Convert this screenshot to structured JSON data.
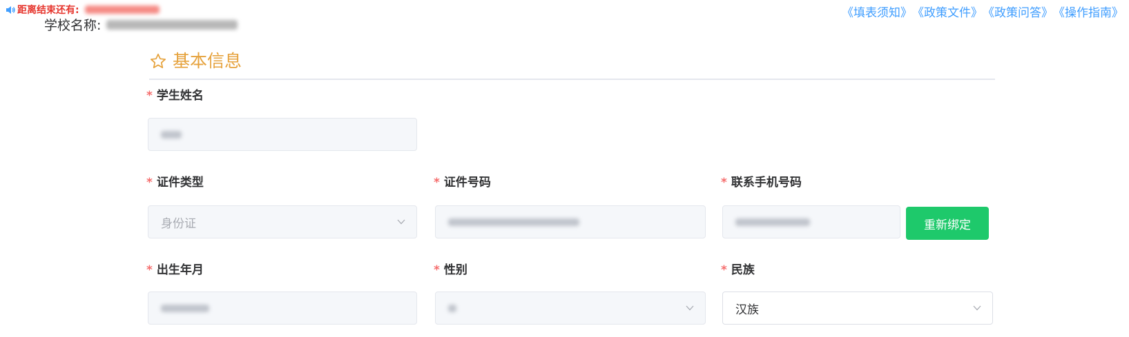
{
  "countdown": {
    "label": "距离结束还有:"
  },
  "school": {
    "label": "学校名称:"
  },
  "links": [
    "《填表须知》",
    "《政策文件》",
    "《政策问答》",
    "《操作指南》"
  ],
  "section": {
    "title": "基本信息",
    "icon": "star-outline-icon"
  },
  "required_mark": "*",
  "fields": {
    "student_name": {
      "label": "学生姓名"
    },
    "id_type": {
      "label": "证件类型",
      "value": "身份证"
    },
    "id_number": {
      "label": "证件号码"
    },
    "phone": {
      "label": "联系手机号码"
    },
    "birth": {
      "label": "出生年月"
    },
    "gender": {
      "label": "性别"
    },
    "ethnicity": {
      "label": "民族",
      "value": "汉族"
    }
  },
  "buttons": {
    "rebind": "重新绑定"
  },
  "colors": {
    "accent": "#e6a23c",
    "link": "#409eff",
    "success": "#1ec96b",
    "danger": "#e6362e"
  }
}
